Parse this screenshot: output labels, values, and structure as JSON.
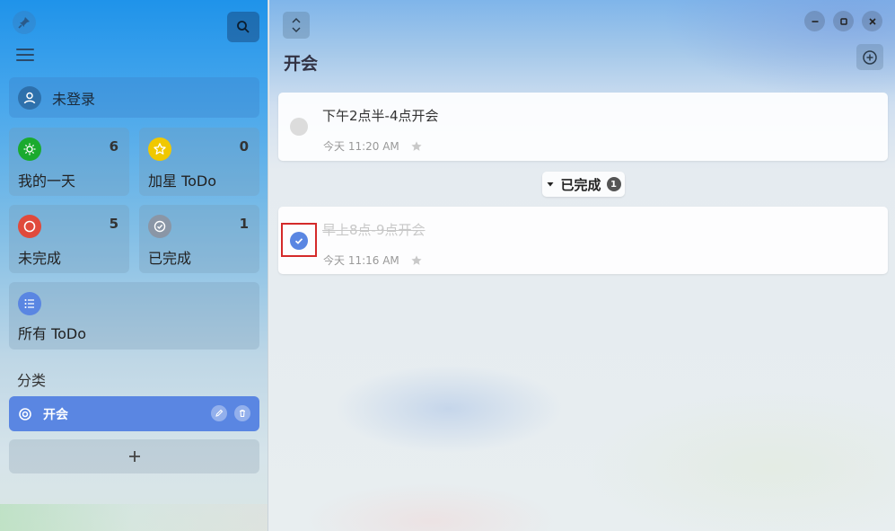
{
  "sidebar": {
    "account_label": "未登录",
    "cards": [
      {
        "label": "我的一天",
        "count": "6",
        "icon": "sun-icon",
        "color": "#1aaa2e"
      },
      {
        "label": "加星 ToDo",
        "count": "0",
        "icon": "star-icon",
        "color": "#f0c800"
      },
      {
        "label": "未完成",
        "count": "5",
        "icon": "circle-icon",
        "color": "#e04a3c"
      },
      {
        "label": "已完成",
        "count": "1",
        "icon": "check-circle-icon",
        "color": "#8a96a6"
      },
      {
        "label": "所有 ToDo",
        "icon": "list-icon",
        "color": "#5a86e2"
      }
    ],
    "section_title": "分类",
    "category": {
      "label": "开会",
      "color": "#5a86e2"
    }
  },
  "main": {
    "page_title": "开会",
    "tasks": [
      {
        "title": "下午2点半-4点开会",
        "time": "今天 11:20 AM",
        "completed": false
      }
    ],
    "done_toggle": {
      "label": "已完成",
      "count": "1"
    },
    "completed_tasks": [
      {
        "title": "早上8点-9点开会",
        "time": "今天 11:16 AM",
        "completed": true
      }
    ]
  }
}
